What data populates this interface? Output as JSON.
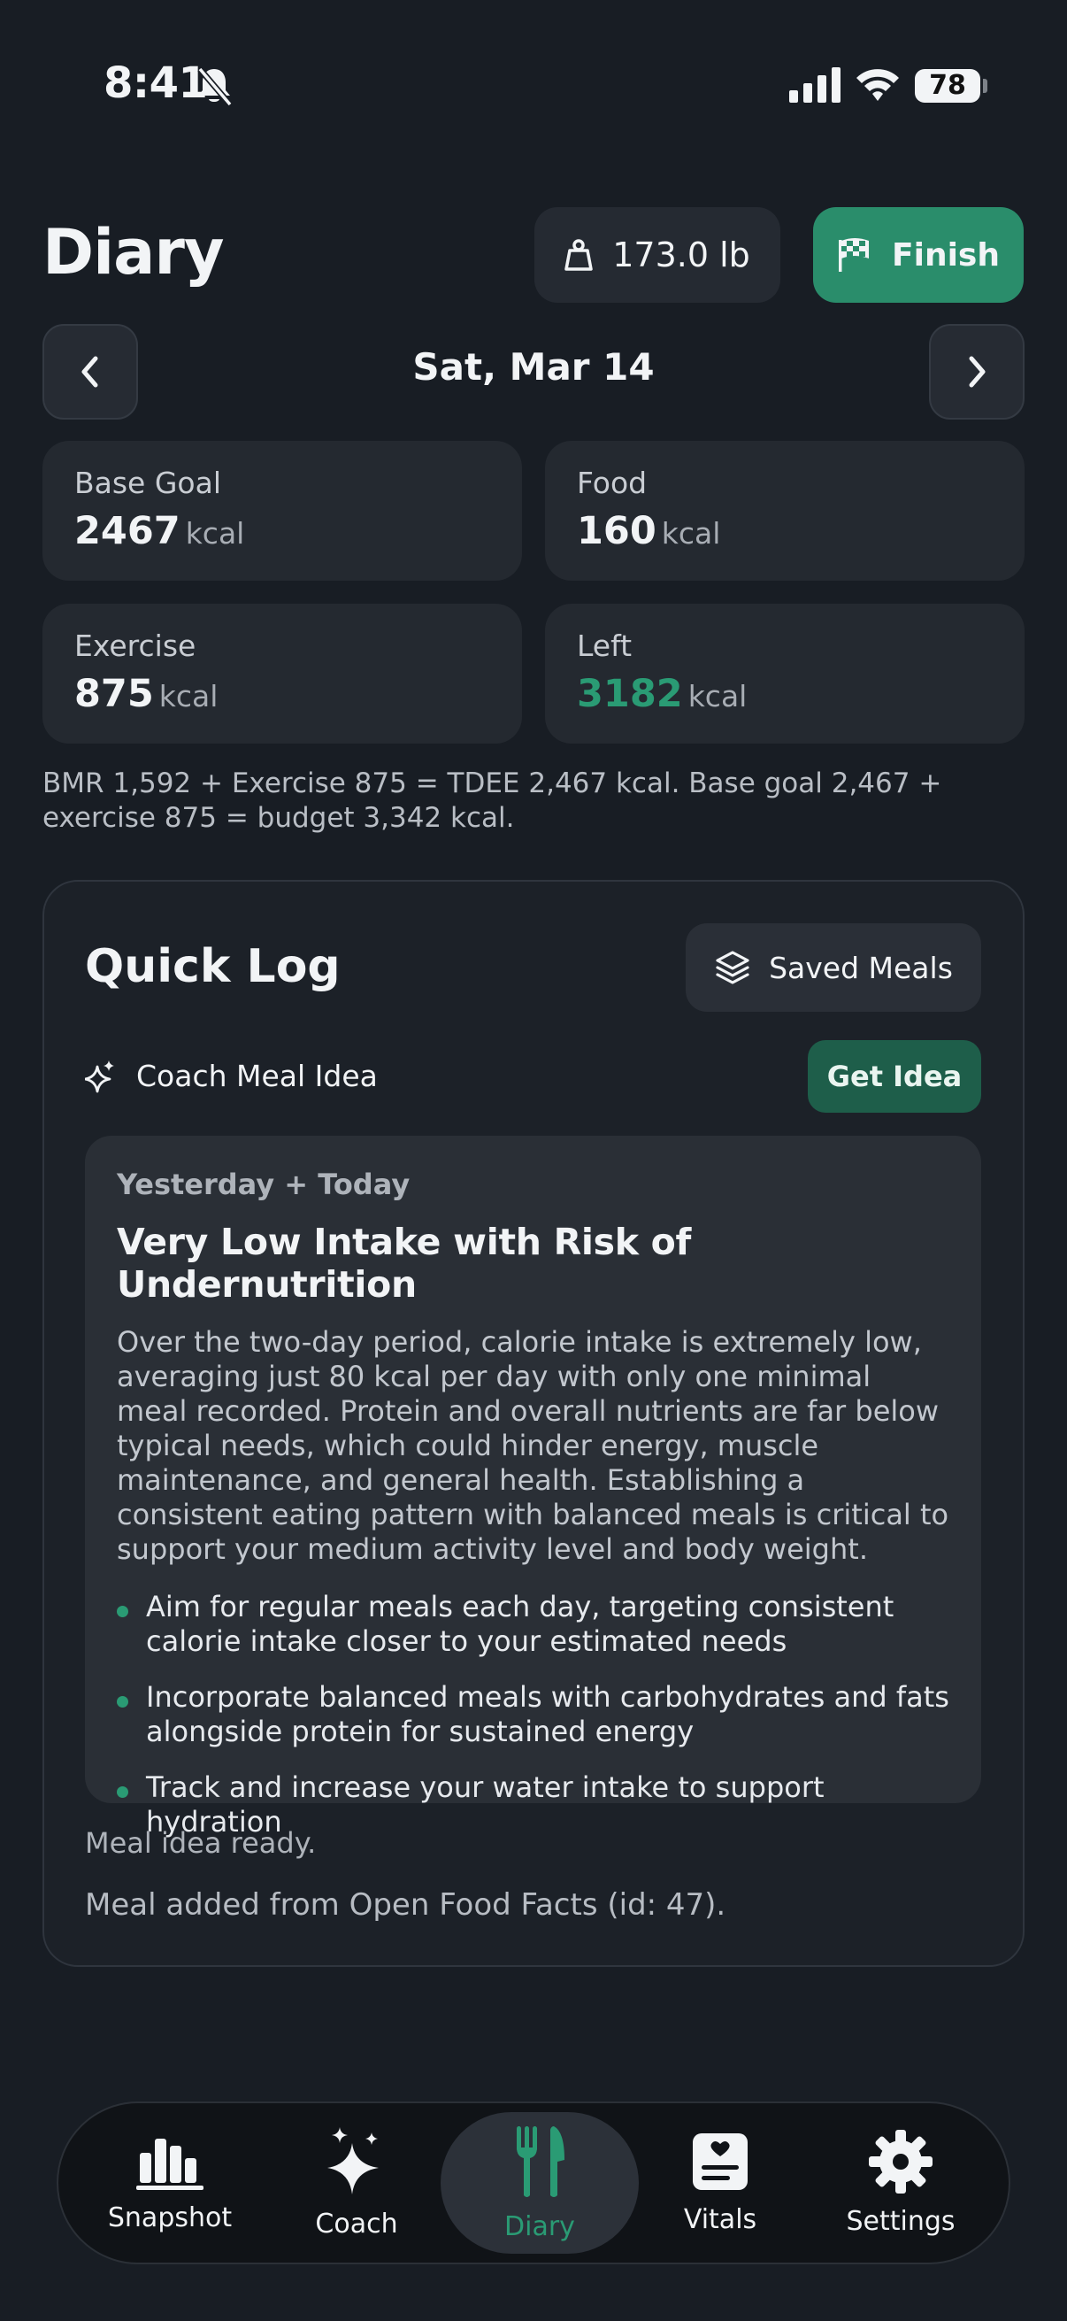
{
  "status_bar": {
    "time": "8:41",
    "battery": "78"
  },
  "header": {
    "title": "Diary",
    "weight": "173.0 lb",
    "finish_label": "Finish",
    "date": "Sat, Mar 14"
  },
  "stats": [
    {
      "label": "Base Goal",
      "value": "2467",
      "unit": "kcal",
      "accent": false
    },
    {
      "label": "Food",
      "value": "160",
      "unit": "kcal",
      "accent": false
    },
    {
      "label": "Exercise",
      "value": "875",
      "unit": "kcal",
      "accent": false
    },
    {
      "label": "Left",
      "value": "3182",
      "unit": "kcal",
      "accent": true
    }
  ],
  "formula": "BMR 1,592 + Exercise 875 = TDEE 2,467 kcal. Base goal 2,467 + exercise 875 = budget 3,342 kcal.",
  "quick_log": {
    "title": "Quick Log",
    "saved_meals_label": "Saved Meals",
    "coach_label": "Coach Meal Idea",
    "get_idea_label": "Get Idea",
    "idea": {
      "subtitle": "Yesterday + Today",
      "title": "Very Low Intake with Risk of Undernutrition",
      "body": "Over the two-day period, calorie intake is extremely low, averaging just 80 kcal per day with only one minimal meal recorded. Protein and overall nutrients are far below typical needs, which could hinder energy, muscle maintenance, and general health. Establishing a consistent eating pattern with balanced meals is critical to support your medium activity level and body weight.",
      "bullets": [
        "Aim for regular meals each day, targeting consistent calorie intake closer to your estimated needs",
        "Incorporate balanced meals with carbohydrates and fats alongside protein for sustained energy",
        "Track and increase your water intake to support hydration"
      ]
    },
    "status_ready": "Meal idea ready.",
    "status_added": "Meal added from Open Food Facts (id: 47)."
  },
  "tabs": [
    {
      "label": "Snapshot",
      "icon": "bar-chart-icon"
    },
    {
      "label": "Coach",
      "icon": "sparkles-icon"
    },
    {
      "label": "Diary",
      "icon": "fork-knife-icon",
      "active": true
    },
    {
      "label": "Vitals",
      "icon": "heart-document-icon"
    },
    {
      "label": "Settings",
      "icon": "gear-icon"
    }
  ],
  "colors": {
    "accent": "#2a9b74",
    "finish_button": "#2a8d6b",
    "background": "#181d24"
  }
}
